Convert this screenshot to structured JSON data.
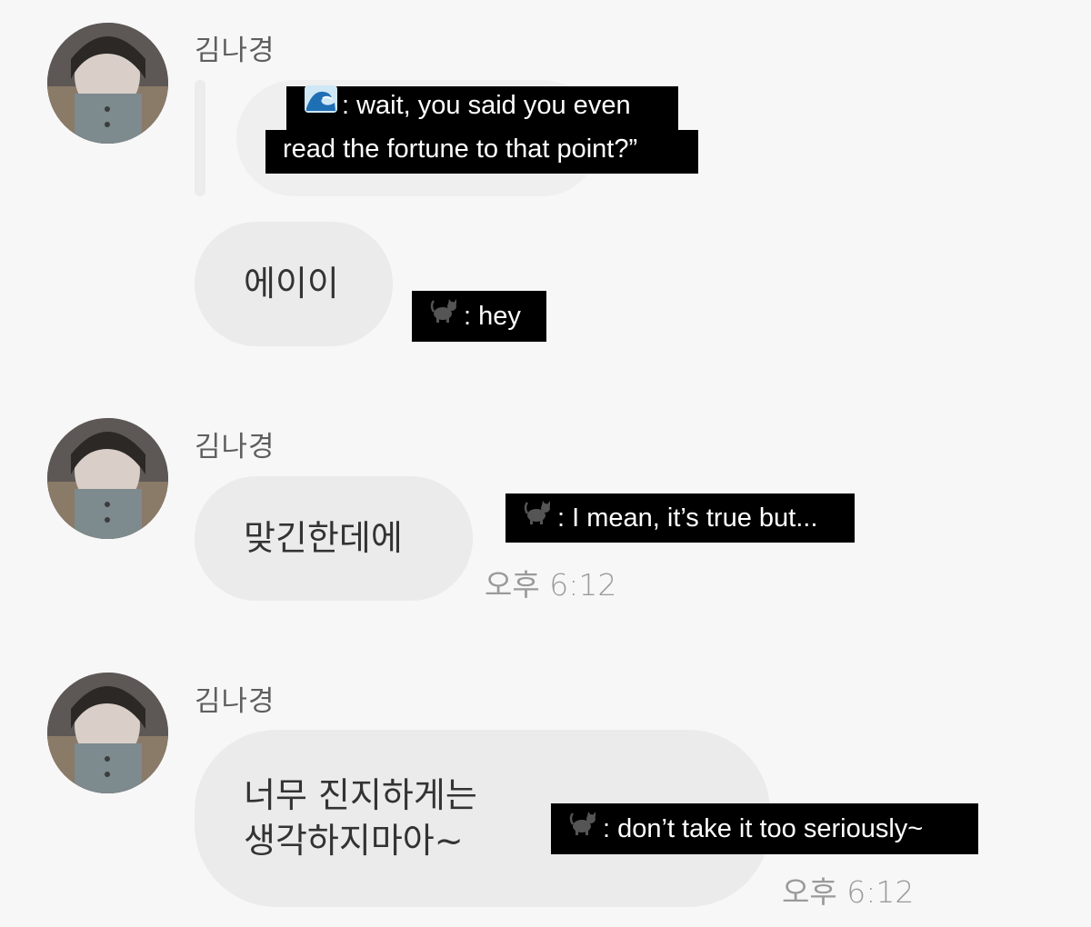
{
  "messages": [
    {
      "sender": "김나경",
      "text": "에이이",
      "reply_quote": "",
      "caption": ": hey",
      "caption_icon": "cat-icon"
    },
    {
      "sender": "김나경",
      "text": "맞긴한데에",
      "time": "오후 6:12",
      "caption": ": I mean, it’s true but...",
      "caption_icon": "cat-icon"
    },
    {
      "sender": "김나경",
      "text": "너무 진지하게는\n생각하지마아~",
      "time": "오후 6:12",
      "caption": ": don’t take it too seriously~",
      "caption_icon": "cat-icon"
    }
  ],
  "reply_caption": {
    "line1": ": wait, you said you even",
    "line2": "read the fortune to that point?”",
    "icon": "wave-icon"
  },
  "colors": {
    "background": "#f7f7f7",
    "bubble": "#ebebeb",
    "caption_bg": "#000000",
    "caption_text": "#ffffff"
  }
}
